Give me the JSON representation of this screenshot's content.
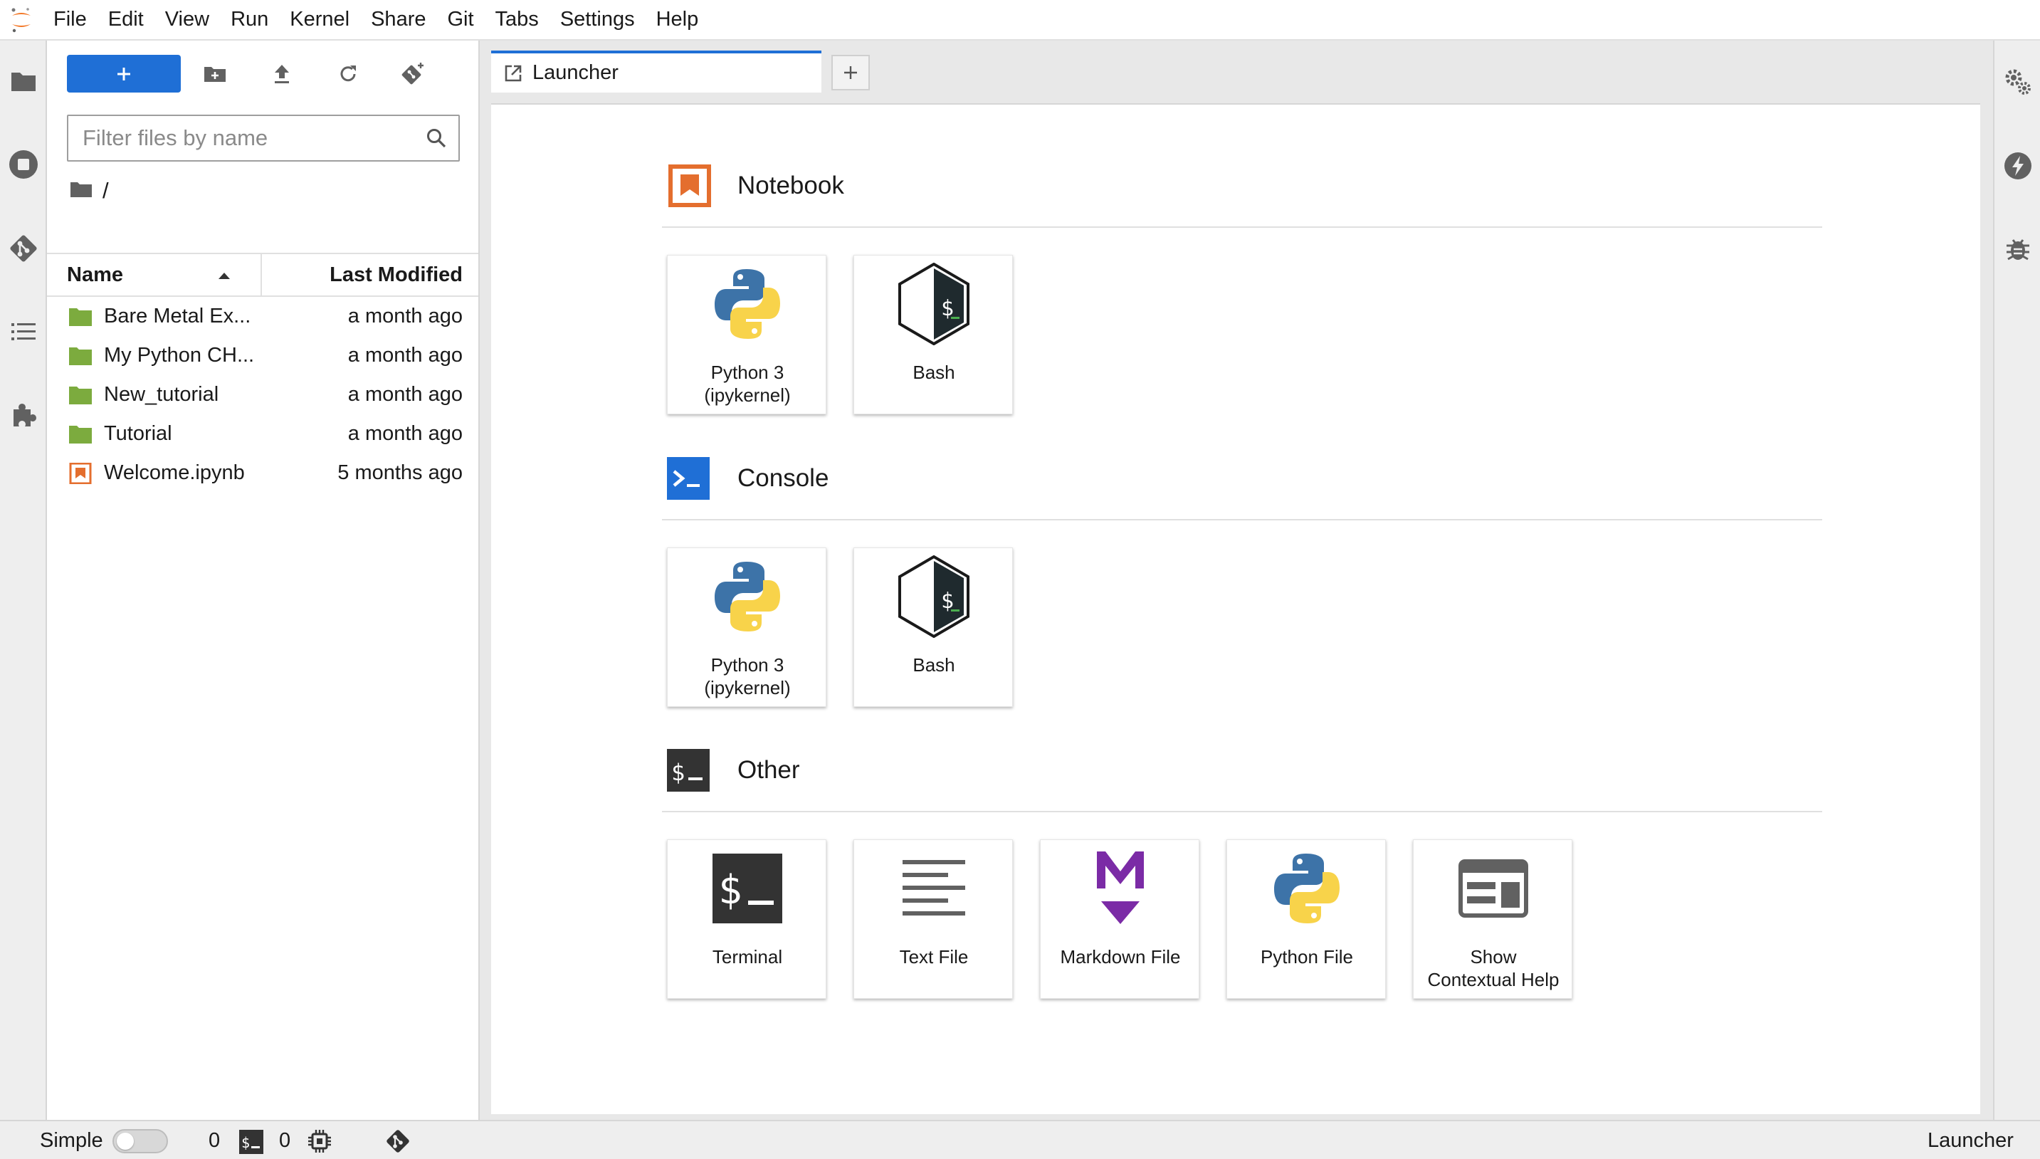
{
  "menubar": {
    "items": [
      "File",
      "Edit",
      "View",
      "Run",
      "Kernel",
      "Share",
      "Git",
      "Tabs",
      "Settings",
      "Help"
    ]
  },
  "filebrowser": {
    "filter_placeholder": "Filter files by name",
    "breadcrumb_root": "/",
    "columns": {
      "name": "Name",
      "modified": "Last Modified"
    },
    "files": [
      {
        "name": "Bare Metal Ex...",
        "modified": "a month ago",
        "type": "folder"
      },
      {
        "name": "My Python CH...",
        "modified": "a month ago",
        "type": "folder"
      },
      {
        "name": "New_tutorial",
        "modified": "a month ago",
        "type": "folder"
      },
      {
        "name": "Tutorial",
        "modified": "a month ago",
        "type": "folder"
      },
      {
        "name": "Welcome.ipynb",
        "modified": "5 months ago",
        "type": "notebook"
      }
    ]
  },
  "tabs": {
    "active_label": "Launcher"
  },
  "launcher": {
    "sections": [
      {
        "title": "Notebook",
        "icon": "notebook-icon",
        "cards": [
          {
            "label": "Python 3\n(ipykernel)",
            "icon": "python-logo-icon"
          },
          {
            "label": "Bash",
            "icon": "bash-logo-icon"
          }
        ]
      },
      {
        "title": "Console",
        "icon": "console-icon",
        "cards": [
          {
            "label": "Python 3\n(ipykernel)",
            "icon": "python-logo-icon"
          },
          {
            "label": "Bash",
            "icon": "bash-logo-icon"
          }
        ]
      },
      {
        "title": "Other",
        "icon": "terminal-icon",
        "cards": [
          {
            "label": "Terminal",
            "icon": "terminal-icon"
          },
          {
            "label": "Text File",
            "icon": "text-file-icon"
          },
          {
            "label": "Markdown File",
            "icon": "markdown-icon"
          },
          {
            "label": "Python File",
            "icon": "python-logo-icon"
          },
          {
            "label": "Show\nContextual Help",
            "icon": "contextual-help-icon"
          }
        ]
      }
    ]
  },
  "statusbar": {
    "mode_label": "Simple",
    "terminals_count": "0",
    "kernels_count": "0",
    "current_panel": "Launcher"
  },
  "colors": {
    "accent": "#1f6fd6",
    "folder": "#7cab3e",
    "notebook": "#e46e2e",
    "markdown": "#7b2ba6"
  }
}
